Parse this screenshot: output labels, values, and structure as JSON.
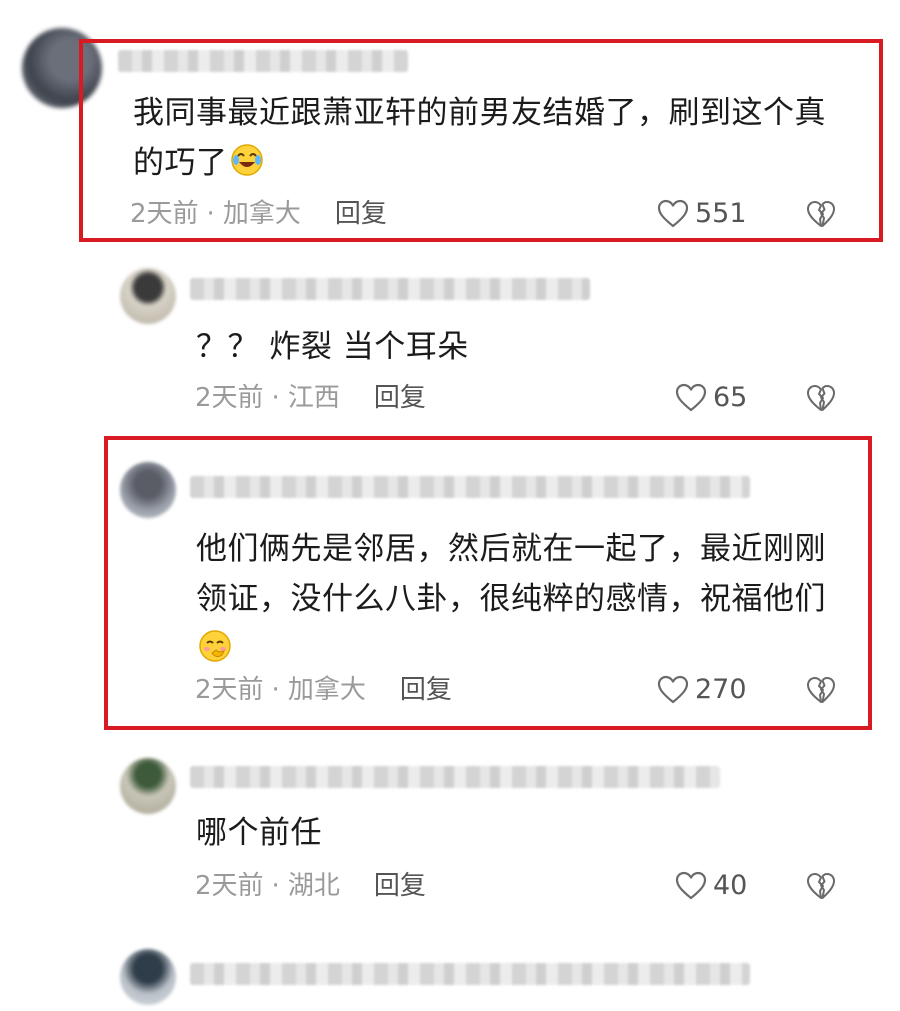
{
  "comments": [
    {
      "text": "我同事最近跟萧亚轩的前男友结婚了，刷到这个真的巧了",
      "time": "2天前",
      "location": "加拿大",
      "reply_label": "回复",
      "likes": "551",
      "emoji": "laugh-cry-emoji"
    },
    {
      "text": "？？ 炸裂 当个耳朵",
      "time": "2天前",
      "location": "江西",
      "reply_label": "回复",
      "likes": "65"
    },
    {
      "text": "他们俩先是邻居，然后就在一起了，最近刚刚领证，没什么八卦，很纯粹的感情，祝福他们",
      "time": "2天前",
      "location": "加拿大",
      "reply_label": "回复",
      "likes": "270",
      "emoji": "blush-hand-emoji"
    },
    {
      "text": "哪个前任",
      "time": "2天前",
      "location": "湖北",
      "reply_label": "回复",
      "likes": "40"
    }
  ],
  "separator": "·",
  "colors": {
    "highlight": "#d81b22",
    "meta_text": "#9a9a9a",
    "body_text": "#1b1b1b"
  }
}
